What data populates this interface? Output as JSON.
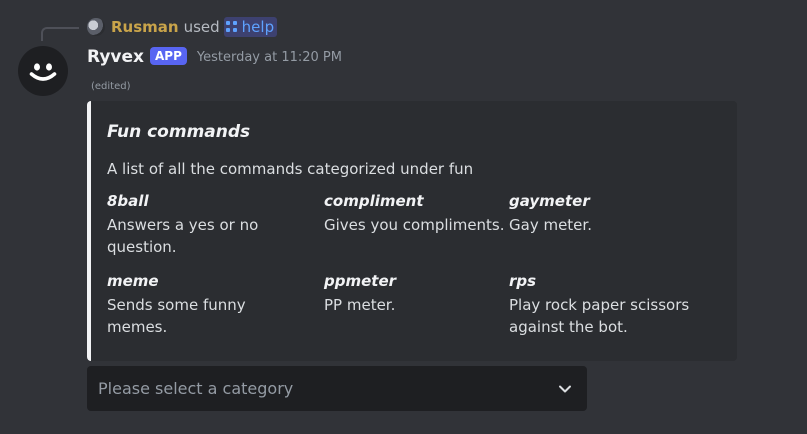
{
  "interaction": {
    "user": "Rusman",
    "used_text": "used",
    "command": "help"
  },
  "message": {
    "author": "Ryvex",
    "badge": "APP",
    "timestamp": "Yesterday at 11:20 PM",
    "edited": "(edited)"
  },
  "embed": {
    "accent_color": "#f2f3f5",
    "title": "Fun commands",
    "description": "A list of all the commands categorized under fun",
    "fields": [
      {
        "name": "8ball",
        "value": "Answers a yes or no question."
      },
      {
        "name": "compliment",
        "value": "Gives you compliments."
      },
      {
        "name": "gaymeter",
        "value": "Gay meter."
      },
      {
        "name": "meme",
        "value": "Sends some funny memes."
      },
      {
        "name": "ppmeter",
        "value": "PP meter."
      },
      {
        "name": "rps",
        "value": "Play rock paper scissors against the bot."
      }
    ]
  },
  "select_menu": {
    "placeholder": "Please select a category",
    "icon": "chevron-down-icon"
  },
  "colors": {
    "background": "#313338",
    "embed_bg": "#2b2d31",
    "app_badge": "#5865f2",
    "interaction_user": "#c9a44a",
    "command_link": "#5ea2ff"
  }
}
